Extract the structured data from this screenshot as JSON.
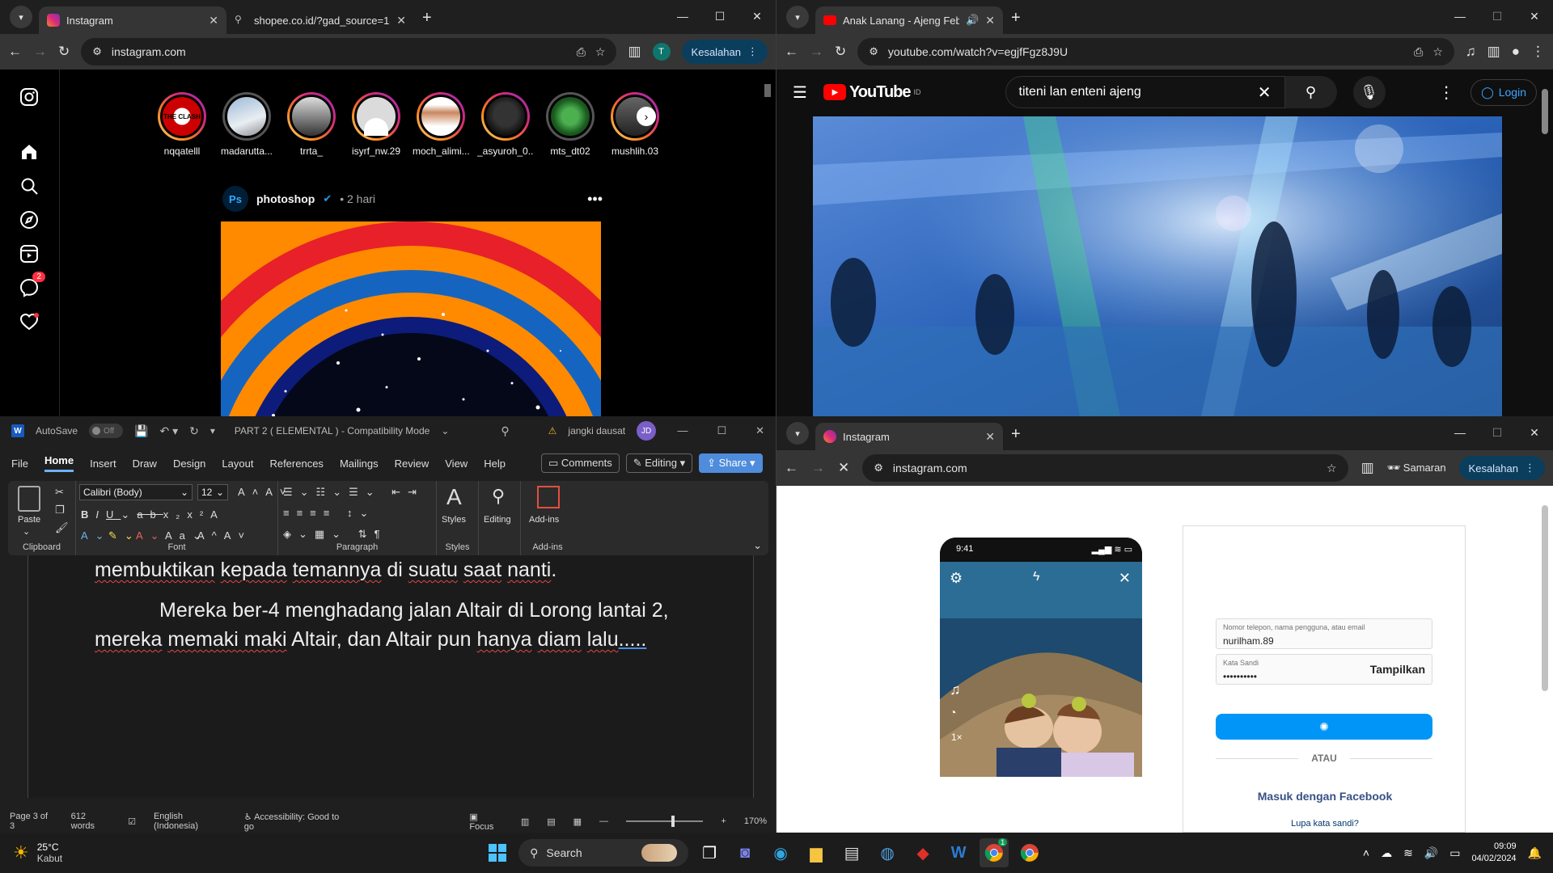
{
  "top_left": {
    "tabs": [
      {
        "title": "Instagram",
        "active": true
      },
      {
        "title": "shopee.co.id/?gad_source=1&",
        "active": false
      }
    ],
    "url": "instagram.com",
    "profile_initial": "T",
    "error_label": "Kesalahan",
    "nav_badge": "2",
    "stories": [
      "nqqatelll",
      "madarutta...",
      "trrta_",
      "isyrf_nw.29",
      "moch_alimi...",
      "_asyuroh_0...",
      "mts_dt02",
      "mushlih.03"
    ],
    "story_logo_text": "THE CLASH",
    "post": {
      "author_avatar": "Ps",
      "author": "photoshop",
      "time": "• 2 hari"
    }
  },
  "top_right": {
    "tab_title": "Anak Lanang - Ajeng Febria",
    "url": "youtube.com/watch?v=egjfFgz8J9U",
    "yt_logo": "YouTube",
    "yt_region": "ID",
    "search_value": "titeni lan enteni ajeng",
    "login_label": "Login"
  },
  "bottom_left": {
    "autosave_label": "AutoSave",
    "autosave_state": "Off",
    "doc_title": "PART 2 ( ELEMENTAL ) - Compatibility Mode",
    "user_name": "jangki dausat",
    "user_initials": "JD",
    "menu": [
      "File",
      "Home",
      "Insert",
      "Draw",
      "Design",
      "Layout",
      "References",
      "Mailings",
      "Review",
      "View",
      "Help"
    ],
    "comments_label": "Comments",
    "editing_label": "Editing",
    "share_label": "Share",
    "font_name": "Calibri (Body)",
    "font_size": "12",
    "groups": {
      "clipboard": "Clipboard",
      "font": "Font",
      "paragraph": "Paragraph",
      "styles": "Styles",
      "addins": "Add-ins"
    },
    "paste_label": "Paste",
    "styles_label": "Styles",
    "editing_btn": "Editing",
    "addins_label": "Add-ins",
    "doc_lines": {
      "l1_a": "membuktikan",
      "l1_b": " ",
      "l1_c": "kepada",
      "l1_d": " ",
      "l1_e": "temannya",
      "l1_f": " di ",
      "l1_g": "suatu",
      "l1_h": " ",
      "l1_i": "saat",
      "l1_j": " ",
      "l1_k": "nanti",
      "l1_l": ".",
      "l2": "Mereka ber-4 menghadang jalan Altair di Lorong lantai 2,",
      "l3_a": "mereka",
      "l3_b": " ",
      "l3_c": "memaki maki",
      "l3_d": " Altair, dan Altair pun ",
      "l3_e": "hanya",
      "l3_f": " ",
      "l3_g": "diam",
      "l3_h": " ",
      "l3_i": "lalu",
      "l3_j": "....."
    },
    "status": {
      "page": "Page 3 of 3",
      "words": "612 words",
      "lang": "English (Indonesia)",
      "access": "Accessibility: Good to go",
      "focus": "Focus",
      "zoom": "170%"
    }
  },
  "bottom_right": {
    "tab_title": "Instagram",
    "url": "instagram.com",
    "incognito_label": "Samaran",
    "error_label": "Kesalahan",
    "phone_time": "9:41",
    "phone_speed": "1×",
    "username_label": "Nomor telepon, nama pengguna, atau email",
    "username_value": "nurilham.89",
    "password_label": "Kata Sandi",
    "password_value": "••••••••••",
    "show_label": "Tampilkan",
    "or_label": "ATAU",
    "facebook_label": "Masuk dengan Facebook",
    "forgot_label": "Lupa kata sandi?"
  },
  "taskbar": {
    "weather_temp": "25°C",
    "weather_desc": "Kabut",
    "search_label": "Search",
    "time": "09:09",
    "date": "04/02/2024",
    "chrome_badge": "1"
  },
  "colors": {
    "ig_blue": "#0095f6",
    "yt_red": "#ff0000",
    "word_blue": "#185abd",
    "chrome_pill": "#0b3e5c"
  }
}
